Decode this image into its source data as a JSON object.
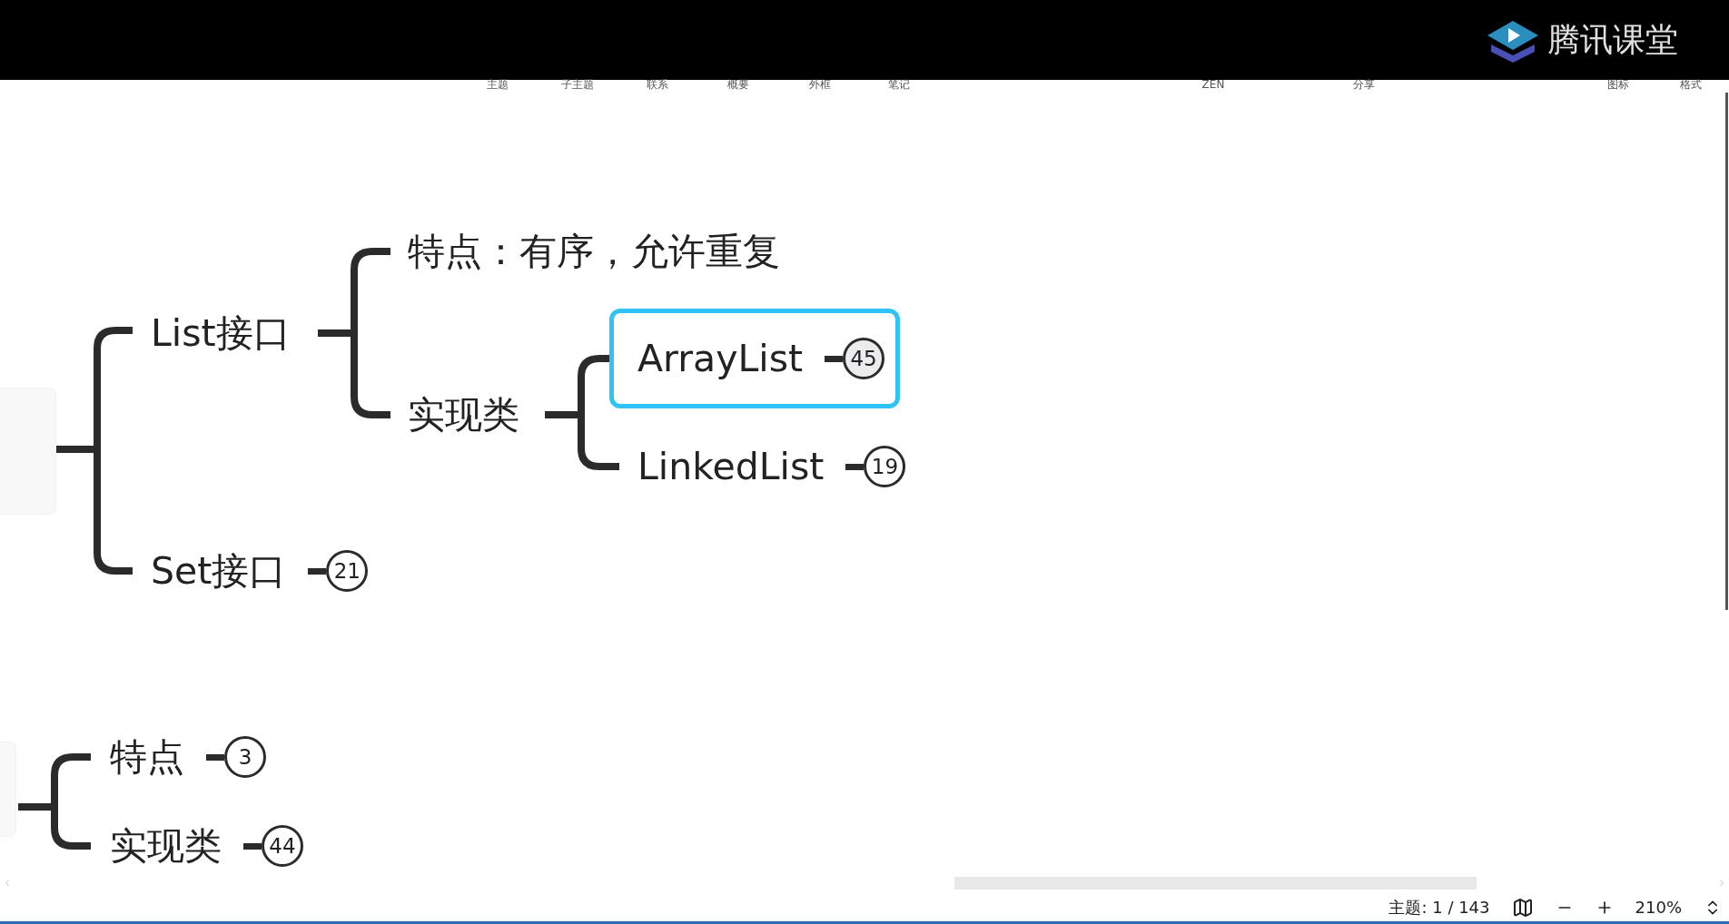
{
  "header": {
    "logo_text": "腾讯课堂"
  },
  "toolbar": {
    "items": [
      "主题",
      "子主题",
      "联系",
      "概要",
      "外框",
      "笔记",
      "ZEN",
      "分享",
      "图标",
      "格式"
    ]
  },
  "mind_map": {
    "groups": [
      {
        "branches": [
          {
            "label": "List接口",
            "selected": false,
            "children": [
              {
                "label": "特点：有序，允许重复",
                "selected": false
              },
              {
                "label": "实现类",
                "selected": false,
                "children": [
                  {
                    "label": "ArrayList",
                    "count": "45",
                    "selected": true
                  },
                  {
                    "label": "LinkedList",
                    "count": "19",
                    "selected": false
                  }
                ]
              }
            ]
          },
          {
            "label": "Set接口",
            "count": "21",
            "selected": false
          }
        ]
      },
      {
        "branches": [
          {
            "label": "特点",
            "count": "3",
            "selected": false
          },
          {
            "label": "实现类",
            "count": "44",
            "selected": false
          }
        ]
      }
    ]
  },
  "status_bar": {
    "topic_count": "主题: 1 / 143",
    "zoom": "210%"
  }
}
